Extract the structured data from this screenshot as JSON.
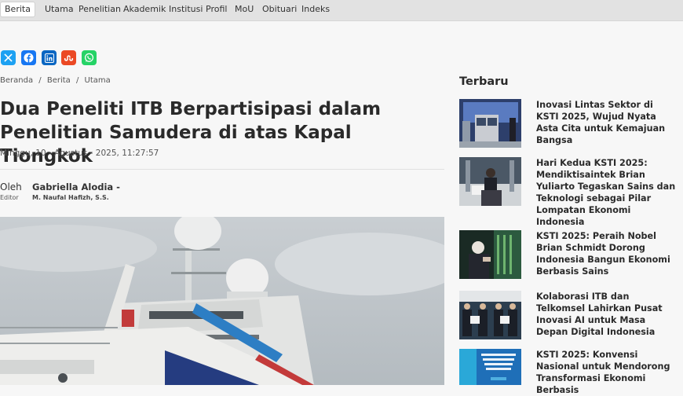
{
  "nav": {
    "items": [
      "Berita",
      "Utama",
      "Penelitian",
      "Akademik",
      "Institusi",
      "Profil",
      "MoU",
      "Obituari",
      "Indeks"
    ]
  },
  "share": {
    "icons": [
      "x-icon",
      "facebook-icon",
      "linkedin-icon",
      "stumbleupon-icon",
      "whatsapp-icon"
    ],
    "colors": [
      "#1da1f2",
      "#1877f2",
      "#0a66c2",
      "#eb4924",
      "#25d366"
    ]
  },
  "breadcrumb": [
    "Beranda",
    "/",
    "Berita",
    "/",
    "Utama"
  ],
  "article": {
    "title": "Dua Peneliti ITB Berpartisipasi dalam Penelitian Samudera di atas Kapal Tiongkok",
    "date": "Minggu, 10 - Agustus - 2025, 11:27:57",
    "oleh_label": "Oleh",
    "editor_label": "Editor",
    "author": "Gabriella Alodia -",
    "editor": "M. Naufal Hafizh, S.S."
  },
  "sidebar": {
    "title": "Terbaru",
    "items": [
      {
        "title": "Inovasi Lintas Sektor di KSTI 2025, Wujud Nyata Asta Cita untuk Kemajuan Bangsa"
      },
      {
        "title": "Hari Kedua KSTI 2025: Mendiktisaintek Brian Yuliarto Tegaskan Sains dan Teknologi sebagai Pilar Lompatan Ekonomi Indonesia"
      },
      {
        "title": "KSTI 2025: Peraih Nobel Brian Schmidt Dorong Indonesia Bangun Ekonomi Berbasis Sains"
      },
      {
        "title": "Kolaborasi ITB dan Telkomsel Lahirkan Pusat Inovasi AI untuk Masa Depan Digital Indonesia"
      },
      {
        "title": "KSTI 2025: Konvensi Nasional untuk Mendorong Transformasi Ekonomi Berbasis"
      }
    ]
  }
}
